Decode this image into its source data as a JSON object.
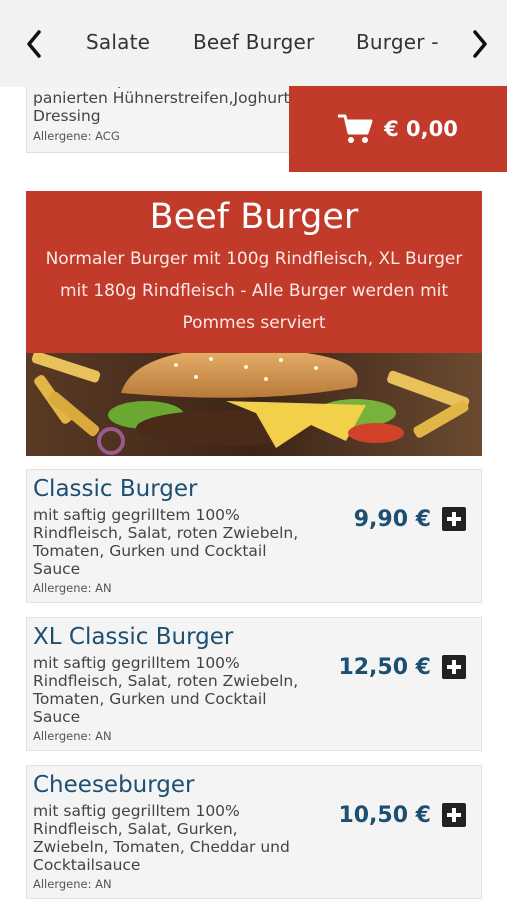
{
  "nav": {
    "back_icon": "chevron-left-icon",
    "forward_icon": "chevron-right-icon",
    "categories": [
      "Salate",
      "Beef Burger",
      "Burger -"
    ]
  },
  "previous_item": {
    "description": "Gurken, Paprika, Salat und panierten Hühnerstreifen,Joghurt Dressing",
    "allergens": "Allergene: ACG"
  },
  "cart": {
    "icon": "shopping-cart-icon",
    "total": "€ 0,00"
  },
  "category": {
    "title": "Beef Burger",
    "description": "Normaler Burger mit 100g Rindfleisch, XL Burger mit 180g Rindfleisch - Alle Burger werden mit Pommes serviert"
  },
  "products": [
    {
      "name": "Classic Burger",
      "description": "mit saftig gegrilltem 100% Rindfleisch, Salat, roten Zwiebeln, Tomaten, Gurken und Cocktail Sauce",
      "allergens": "Allergene: AN",
      "price": "9,90 €"
    },
    {
      "name": "XL Classic Burger",
      "description": "mit saftig gegrilltem 100% Rindfleisch, Salat, roten Zwiebeln, Tomaten, Gurken und Cocktail Sauce",
      "allergens": "Allergene: AN",
      "price": "12,50 €"
    },
    {
      "name": "Cheeseburger",
      "description": "mit saftig gegrilltem 100% Rindfleisch, Salat, Gurken, Zwiebeln, Tomaten, Cheddar und Cocktailsauce",
      "allergens": "Allergene: AN",
      "price": "10,50 €"
    }
  ],
  "colors": {
    "accent": "#c23b2a",
    "product_title": "#1d4f73",
    "nav_background": "#f2f2f2"
  }
}
